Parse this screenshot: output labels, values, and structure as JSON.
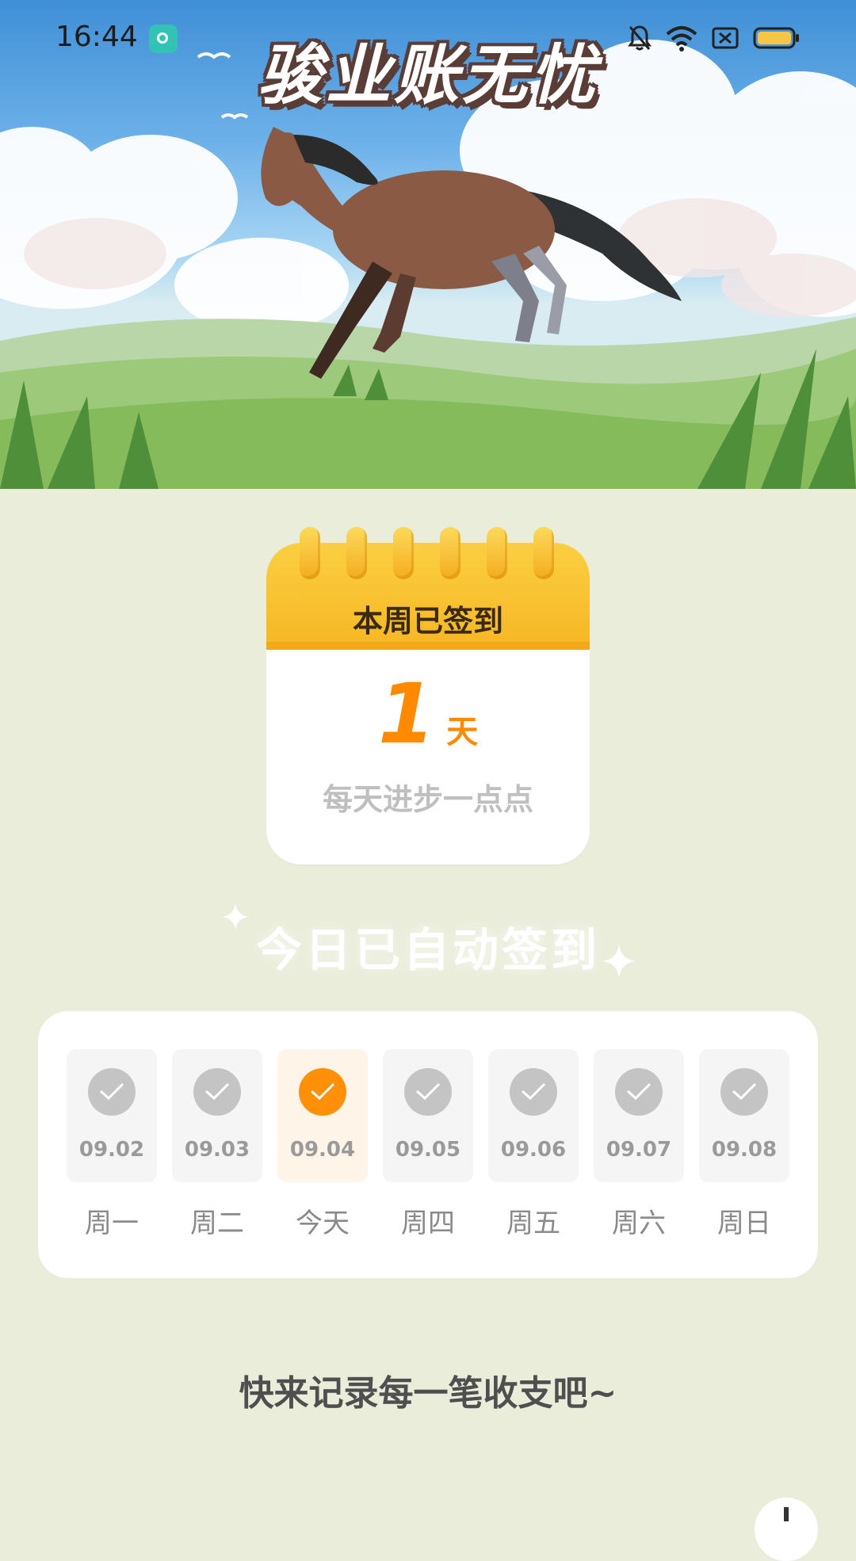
{
  "status_bar": {
    "time": "16:44",
    "icons": [
      "app-notification-icon",
      "bell-off-icon",
      "wifi-icon",
      "sim-off-icon",
      "battery-icon"
    ],
    "battery_color": "#f7c646"
  },
  "hero": {
    "title": "骏业账无忧"
  },
  "checkin_card": {
    "title": "本周已签到",
    "count": "1",
    "unit": "天",
    "motto": "每天进步一点点",
    "accent_color": "#ff8a00",
    "header_color": "#f8bf2e"
  },
  "auto_sign_text": "今日已自动签到",
  "week": {
    "days": [
      {
        "date": "09.02",
        "label": "周一",
        "today": false
      },
      {
        "date": "09.03",
        "label": "周二",
        "today": false
      },
      {
        "date": "09.04",
        "label": "今天",
        "today": true
      },
      {
        "date": "09.05",
        "label": "周四",
        "today": false
      },
      {
        "date": "09.06",
        "label": "周五",
        "today": false
      },
      {
        "date": "09.07",
        "label": "周六",
        "today": false
      },
      {
        "date": "09.08",
        "label": "周日",
        "today": false
      }
    ],
    "today_color": "#ff9008",
    "done_color": "#c4c4c4"
  },
  "prompt_text": "快来记录每一笔收支吧~"
}
